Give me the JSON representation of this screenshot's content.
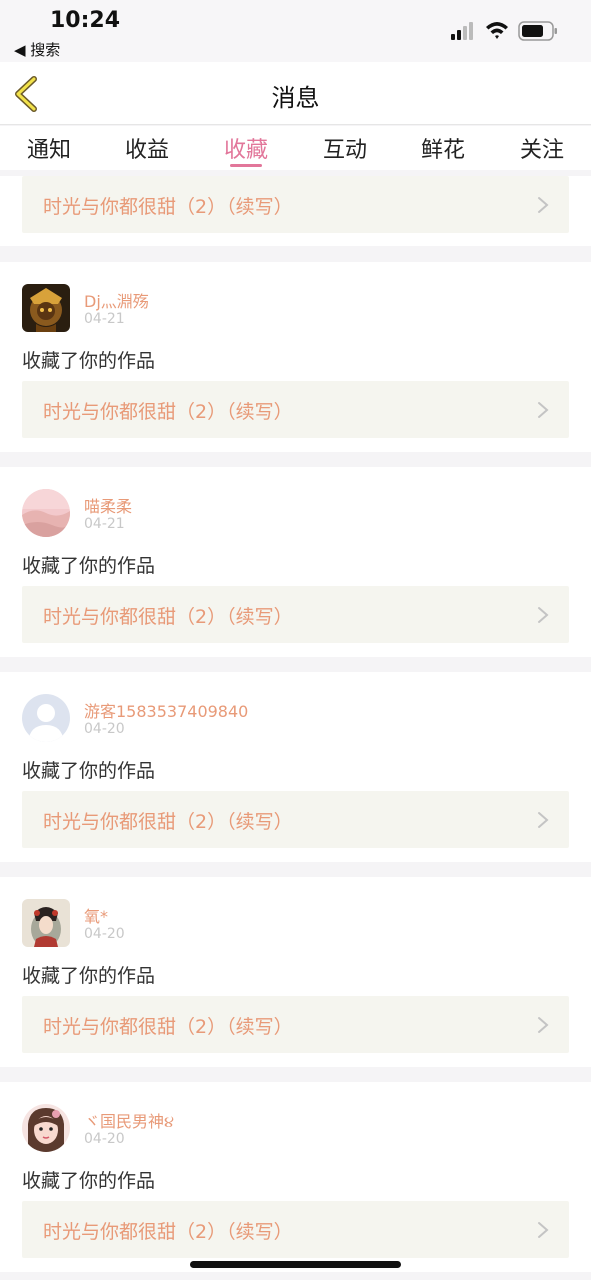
{
  "status_bar": {
    "time": "10:24",
    "back_app": "◀ 搜索"
  },
  "header": {
    "title": "消息"
  },
  "tabs": [
    {
      "label": "通知"
    },
    {
      "label": "收益"
    },
    {
      "label": "收藏"
    },
    {
      "label": "互动"
    },
    {
      "label": "鲜花"
    },
    {
      "label": "关注"
    }
  ],
  "active_tab": "收藏",
  "colors": {
    "accent": "#e2769a",
    "username": "#e89a78",
    "work_box": "#f5f5ef"
  },
  "partial_item": {
    "work_title": "时光与你都很甜（2）（续写）"
  },
  "items": [
    {
      "username": "Dj灬淵殇",
      "date": "04-21",
      "action": "收藏了你的作品",
      "work_title": "时光与你都很甜（2）（续写）",
      "avatar": "warrior-avatar"
    },
    {
      "username": "喵柔柔",
      "date": "04-21",
      "action": "收藏了你的作品",
      "work_title": "时光与你都很甜（2）（续写）",
      "avatar": "pink-sky-avatar"
    },
    {
      "username": "游客1583537409840",
      "date": "04-20",
      "action": "收藏了你的作品",
      "work_title": "时光与你都很甜（2）（续写）",
      "avatar": "default-user-avatar"
    },
    {
      "username": "氧*",
      "date": "04-20",
      "action": "收藏了你的作品",
      "work_title": "时光与你都很甜（2）（续写）",
      "avatar": "geisha-avatar"
    },
    {
      "username": "ヾ国民男神૪",
      "date": "04-20",
      "action": "收藏了你的作品",
      "work_title": "时光与你都很甜（2）（续写）",
      "avatar": "girl-photo-avatar"
    }
  ]
}
